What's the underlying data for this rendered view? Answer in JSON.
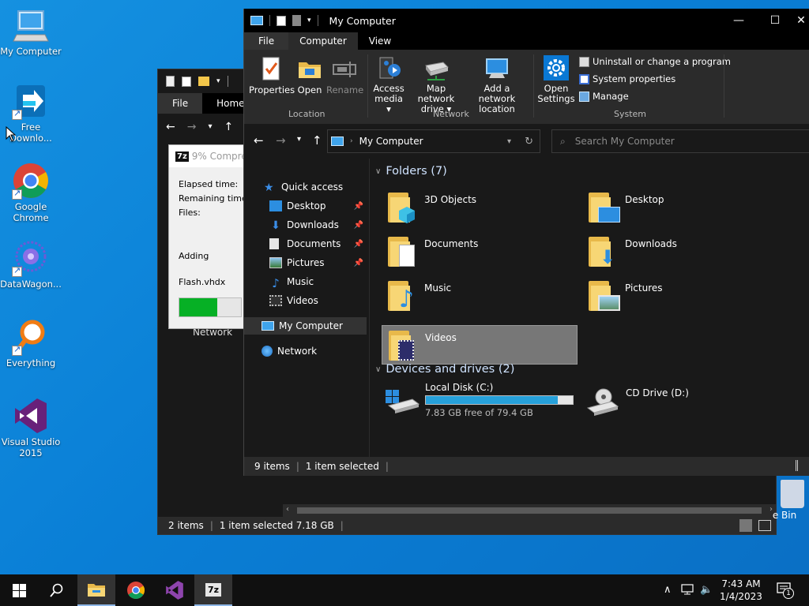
{
  "desktop": {
    "icons": [
      {
        "label": "My Computer"
      },
      {
        "label": "Free Downlo..."
      },
      {
        "label": "Google Chrome"
      },
      {
        "label": "DataWagon..."
      },
      {
        "label": "Everything"
      },
      {
        "label": "Visual Studio 2015"
      }
    ],
    "recycle_bin_label": "e Bin"
  },
  "back_window": {
    "tabs": [
      "File",
      "Home"
    ],
    "active_tab": "Home",
    "nav_item": "Network",
    "status": {
      "items": "2 items",
      "selected": "1 item selected  7.18 GB"
    }
  },
  "zip_dialog": {
    "badge": "7z",
    "title": "9% Compre",
    "elapsed_label": "Elapsed time:",
    "remaining_label": "Remaining time:",
    "files_label": "Files:",
    "action": "Adding",
    "file": "Flash.vhdx",
    "progress": 0.62
  },
  "main_window": {
    "title": "My Computer",
    "window_controls": {
      "minimize": "—",
      "maximize": "☐",
      "close": "✕"
    },
    "ribbon_tabs": [
      "File",
      "Computer",
      "View"
    ],
    "active_tab": "Computer",
    "ribbon": {
      "location": {
        "group": "Location",
        "properties": "Properties",
        "open": "Open",
        "rename": "Rename"
      },
      "network": {
        "group": "Network",
        "access_media": [
          "Access",
          "media ▾"
        ],
        "map_drive": [
          "Map network",
          "drive ▾"
        ],
        "add_location": [
          "Add a network",
          "location"
        ]
      },
      "system": {
        "group": "System",
        "open_settings": [
          "Open",
          "Settings"
        ],
        "uninstall": "Uninstall or change a program",
        "system_properties": "System properties",
        "manage": "Manage"
      }
    },
    "address": {
      "path": "My Computer",
      "search_placeholder": "Search My Computer"
    },
    "nav_pane": {
      "quick_access": "Quick access",
      "items": [
        {
          "label": "Desktop",
          "pinned": true
        },
        {
          "label": "Downloads",
          "pinned": true
        },
        {
          "label": "Documents",
          "pinned": true
        },
        {
          "label": "Pictures",
          "pinned": true
        },
        {
          "label": "Music",
          "pinned": false
        },
        {
          "label": "Videos",
          "pinned": false
        }
      ],
      "my_computer": "My Computer",
      "network": "Network"
    },
    "folders_header": "Folders (7)",
    "folders": [
      {
        "name": "3D Objects"
      },
      {
        "name": "Desktop"
      },
      {
        "name": "Documents"
      },
      {
        "name": "Downloads"
      },
      {
        "name": "Music"
      },
      {
        "name": "Pictures"
      },
      {
        "name": "Videos",
        "selected": true
      }
    ],
    "devices_header": "Devices and drives (2)",
    "drives": [
      {
        "name": "Local Disk (C:)",
        "free": "7.83 GB free of 79.4 GB",
        "used_fraction": 0.9
      },
      {
        "name": "CD Drive (D:)"
      }
    ],
    "status": {
      "items": "9 items",
      "selected": "1 item selected"
    }
  },
  "taskbar": {
    "time": "7:43 AM",
    "date": "1/4/2023",
    "notification_count": "1"
  },
  "colors": {
    "accent": "#1591e0",
    "progress_green": "#06b025",
    "drive_bar": "#26a0da"
  }
}
